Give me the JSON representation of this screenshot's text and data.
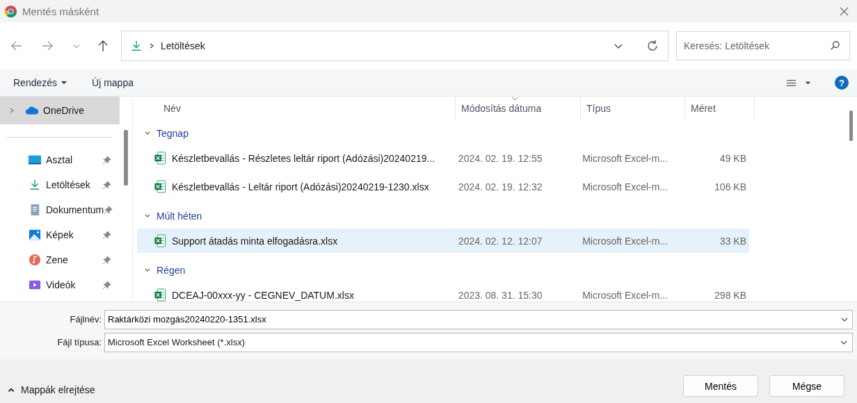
{
  "window": {
    "title": "Mentés másként"
  },
  "nav": {
    "path": "Letöltések",
    "search_placeholder": "Keresés: Letöltések"
  },
  "toolbar": {
    "organize": "Rendezés",
    "new_folder": "Új mappa",
    "help": "?"
  },
  "sidebar": {
    "items": [
      {
        "label": "OneDrive",
        "kind": "cloud",
        "selected": true,
        "pinned": false
      },
      {
        "label": "Asztal",
        "kind": "desktop",
        "selected": false,
        "pinned": true
      },
      {
        "label": "Letöltések",
        "kind": "download",
        "selected": false,
        "pinned": true
      },
      {
        "label": "Dokumentum",
        "kind": "document",
        "selected": false,
        "pinned": true
      },
      {
        "label": "Képek",
        "kind": "pictures",
        "selected": false,
        "pinned": true
      },
      {
        "label": "Zene",
        "kind": "music",
        "selected": false,
        "pinned": true
      },
      {
        "label": "Videók",
        "kind": "video",
        "selected": false,
        "pinned": true
      }
    ]
  },
  "table": {
    "columns": [
      {
        "label": "Név",
        "sorted": false
      },
      {
        "label": "Módosítás dátuma",
        "sorted": true
      },
      {
        "label": "Típus",
        "sorted": false
      },
      {
        "label": "Méret",
        "sorted": false
      }
    ],
    "groups": [
      {
        "label": "Tegnap",
        "expanded": true,
        "rows": [
          {
            "name": "Készletbevallás - Részletes leltár riport (Adózási)20240219...",
            "date": "2024. 02. 19. 12:55",
            "type": "Microsoft Excel-m...",
            "size": "49 KB",
            "selected": false
          },
          {
            "name": "Készletbevallás - Leltár riport (Adózási)20240219-1230.xlsx",
            "date": "2024. 02. 19. 12:32",
            "type": "Microsoft Excel-m...",
            "size": "106 KB",
            "selected": false
          }
        ]
      },
      {
        "label": "Múlt héten",
        "expanded": true,
        "rows": [
          {
            "name": "Support átadás minta elfogadásra.xlsx",
            "date": "2024. 02. 12. 12:07",
            "type": "Microsoft Excel-m...",
            "size": "33 KB",
            "selected": true
          }
        ]
      },
      {
        "label": "Régen",
        "expanded": true,
        "rows": [
          {
            "name": "DCEAJ-00xxx-yy - CEGNEV_DATUM.xlsx",
            "date": "2023. 08. 31. 15:30",
            "type": "Microsoft Excel-m...",
            "size": "298 KB",
            "selected": false
          }
        ]
      }
    ]
  },
  "form": {
    "filename_label": "Fájlnév:",
    "filename": "Raktárközi mozgás20240220-1351.xlsx",
    "filetype_label": "Fájl típusa:",
    "filetype": "Microsoft Excel Worksheet (*.xlsx)"
  },
  "footer": {
    "hide_folders": "Mappák elrejtése",
    "buttons": [
      "Mentés",
      "Mégse"
    ]
  }
}
